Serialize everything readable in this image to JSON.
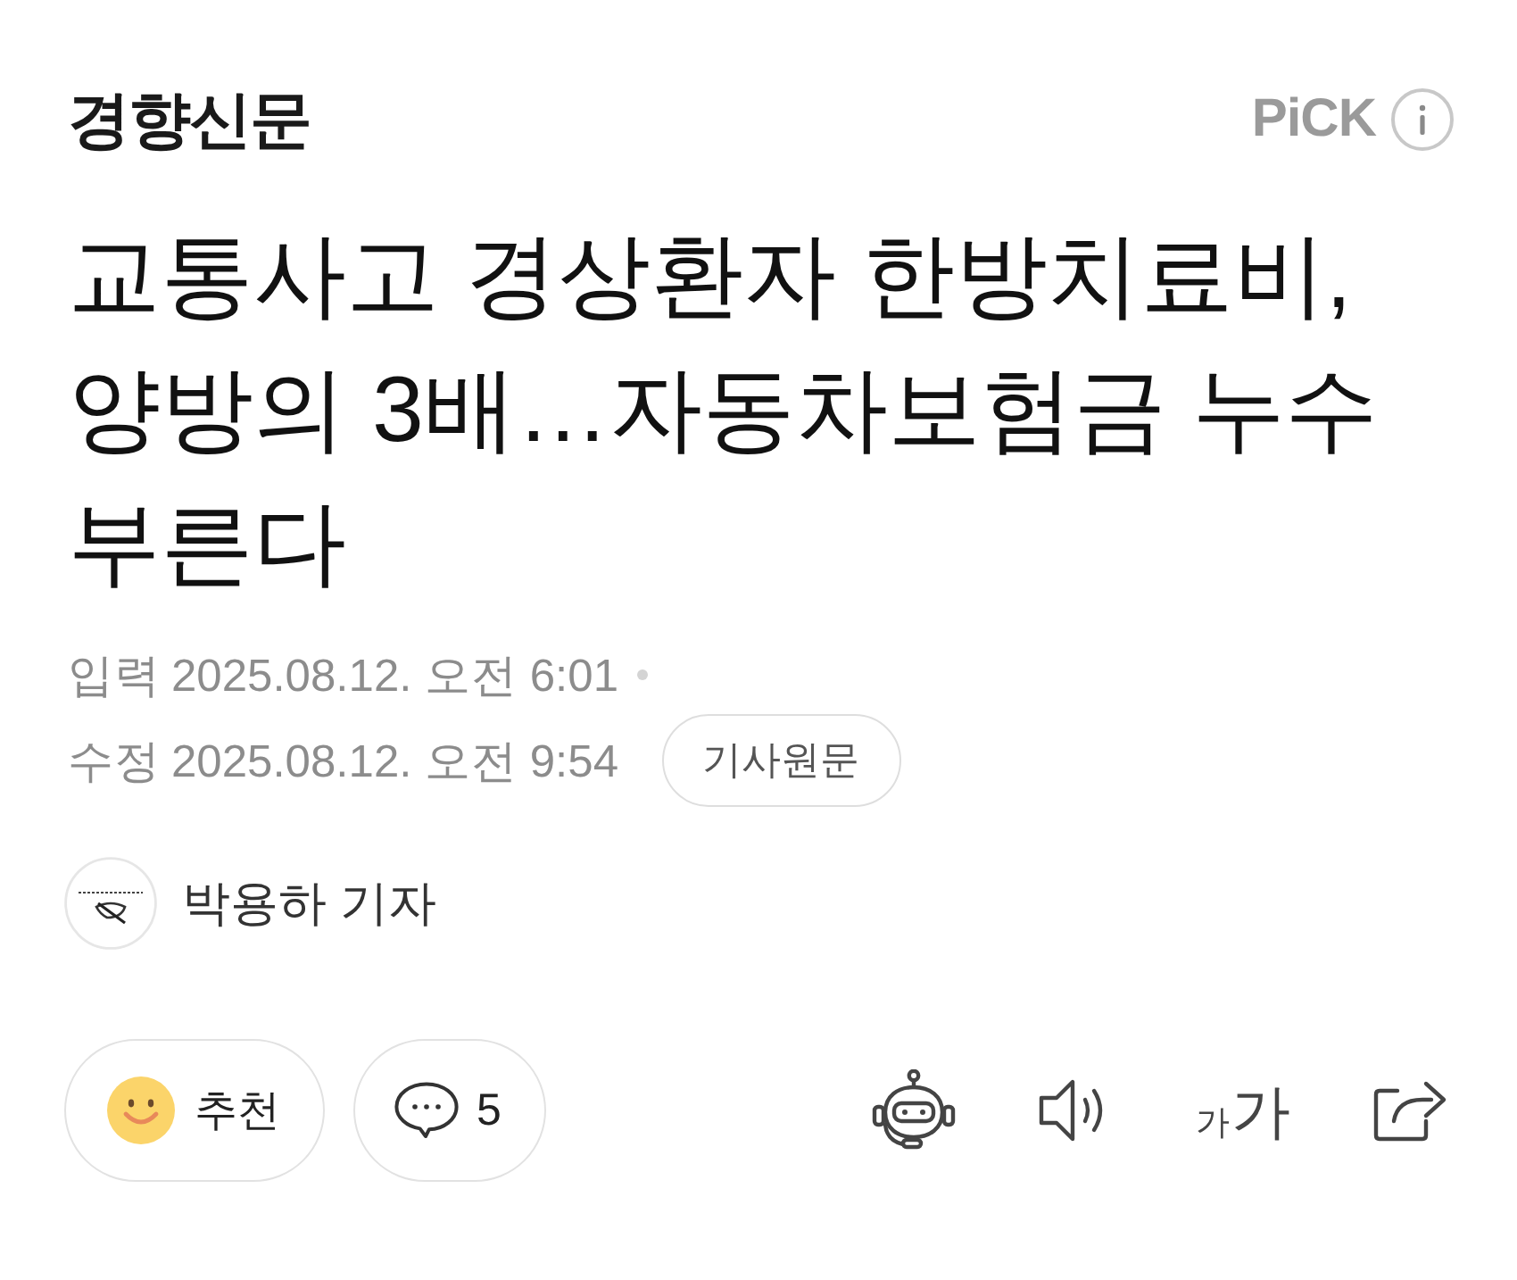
{
  "header": {
    "logo": "경향신문",
    "pick_label": "PiCK"
  },
  "headline": "교통사고 경상환자 한방치료비, 양방의 3배…자동차보험금 누수 부른다",
  "dates": [
    {
      "label": "입력",
      "value": "2025.08.12. 오전 6:01"
    },
    {
      "label": "수정",
      "value": "2025.08.12. 오전 9:54"
    }
  ],
  "original_article_button": "기사원문",
  "reporter": {
    "name": "박용하 기자"
  },
  "actions": {
    "recommend_label": "추천",
    "comment_count": "5"
  },
  "tools": [
    {
      "kind": "robot"
    },
    {
      "kind": "speaker"
    },
    {
      "kind": "font_size",
      "small_label": "가",
      "large_label": "가"
    },
    {
      "kind": "share"
    }
  ]
}
